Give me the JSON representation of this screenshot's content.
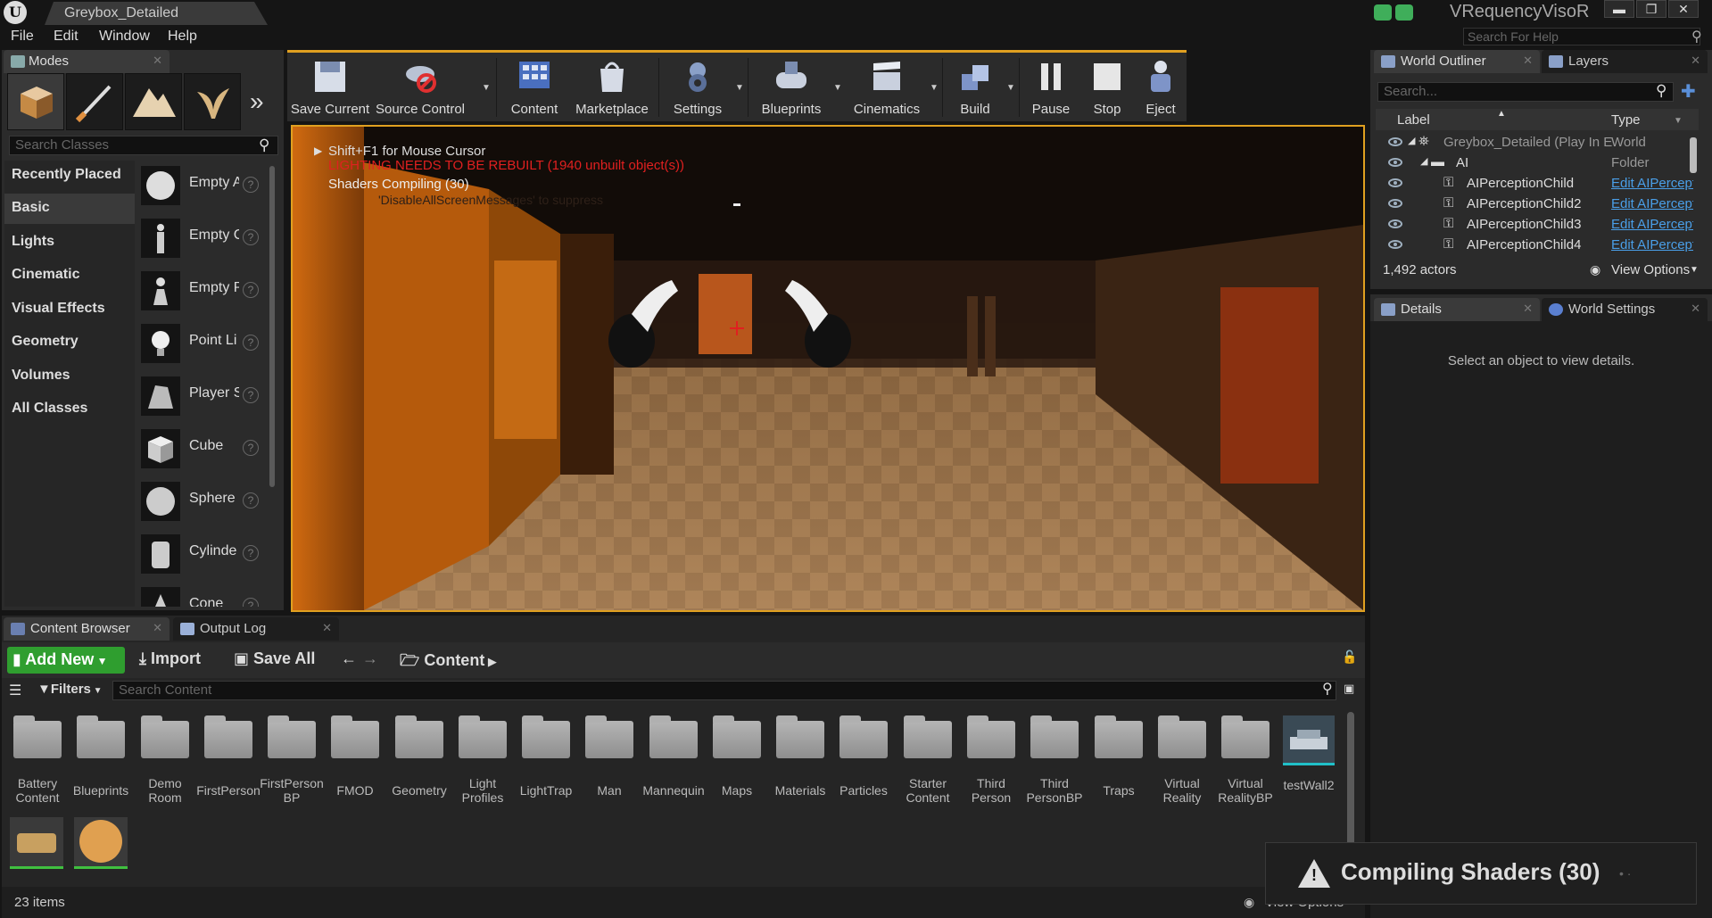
{
  "window": {
    "project_tab": "Greybox_Detailed",
    "studio_name": "VRequencyVisoR",
    "help_search_placeholder": "Search For Help",
    "controls": {
      "minimize": "▬",
      "maximize": "❐",
      "close": "✕"
    }
  },
  "menu": {
    "items": [
      "File",
      "Edit",
      "Window",
      "Help"
    ]
  },
  "modes": {
    "tab_label": "Modes",
    "search_placeholder": "Search Classes",
    "categories": [
      "Recently Placed",
      "Basic",
      "Lights",
      "Cinematic",
      "Visual Effects",
      "Geometry",
      "Volumes",
      "All Classes"
    ],
    "active_category": "Basic",
    "classes": [
      {
        "name": "Empty A",
        "icon": "sphere-icon"
      },
      {
        "name": "Empty C",
        "icon": "mannequin-icon"
      },
      {
        "name": "Empty P",
        "icon": "pawn-icon"
      },
      {
        "name": "Point Li",
        "icon": "lightbulb-icon"
      },
      {
        "name": "Player S",
        "icon": "player-start-icon"
      },
      {
        "name": "Cube",
        "icon": "cube-icon"
      },
      {
        "name": "Sphere",
        "icon": "sphere-icon"
      },
      {
        "name": "Cylinde",
        "icon": "cylinder-icon"
      },
      {
        "name": "Cone",
        "icon": "cone-icon"
      }
    ]
  },
  "toolbar": {
    "buttons": [
      {
        "label": "Save Current",
        "icon": "save-icon"
      },
      {
        "label": "Source Control",
        "icon": "source-control-icon"
      },
      {
        "label": "Content",
        "icon": "content-icon"
      },
      {
        "label": "Marketplace",
        "icon": "marketplace-icon"
      },
      {
        "label": "Settings",
        "icon": "settings-icon"
      },
      {
        "label": "Blueprints",
        "icon": "blueprints-icon"
      },
      {
        "label": "Cinematics",
        "icon": "cinematics-icon"
      },
      {
        "label": "Build",
        "icon": "build-icon"
      },
      {
        "label": "Pause",
        "icon": "pause-icon"
      },
      {
        "label": "Stop",
        "icon": "stop-icon"
      },
      {
        "label": "Eject",
        "icon": "eject-icon"
      }
    ]
  },
  "viewport": {
    "hint": "Shift+F1 for Mouse Cursor",
    "lighting_warning": "LIGHTING NEEDS TO BE REBUILT (1940 unbuilt object(s))",
    "shaders_status": "Shaders Compiling (30)",
    "suppress_hint": "'DisableAllScreenMessages' to suppress"
  },
  "content_browser": {
    "tabs": [
      "Content Browser",
      "Output Log"
    ],
    "add_new": "Add New",
    "import": "Import",
    "save_all": "Save All",
    "path": "Content",
    "filters": "Filters",
    "search_placeholder": "Search Content",
    "folders": [
      "Battery Content",
      "Blueprints",
      "Demo Room",
      "FirstPerson",
      "FirstPerson BP",
      "FMOD",
      "Geometry",
      "Light Profiles",
      "LightTrap",
      "Man",
      "Mannequin",
      "Maps",
      "Materials",
      "Particles",
      "Starter Content",
      "Third Person",
      "Third PersonBP",
      "Traps",
      "Virtual Reality",
      "Virtual RealityBP",
      "testWall2"
    ],
    "item_count": "23 items",
    "view_options": "View Options"
  },
  "outliner": {
    "tabs": [
      "World Outliner",
      "Layers"
    ],
    "search_placeholder": "Search...",
    "col_label": "Label",
    "col_type": "Type",
    "rows": [
      {
        "label": "Greybox_Detailed (Play In Editor)",
        "type": "World",
        "indent": 0
      },
      {
        "label": "AI",
        "type": "Folder",
        "indent": 1
      },
      {
        "label": "AIPerceptionChild",
        "type": "Edit AIPerception",
        "indent": 2
      },
      {
        "label": "AIPerceptionChild2",
        "type": "Edit AIPerception",
        "indent": 2
      },
      {
        "label": "AIPerceptionChild3",
        "type": "Edit AIPerception",
        "indent": 2
      },
      {
        "label": "AIPerceptionChild4",
        "type": "Edit AIPerception",
        "indent": 2
      }
    ],
    "actor_count": "1,492 actors",
    "view_options": "View Options"
  },
  "details": {
    "tabs": [
      "Details",
      "World Settings"
    ],
    "empty_message": "Select an object to view details."
  },
  "toast": {
    "message": "Compiling Shaders (30)"
  },
  "colors": {
    "accent_orange": "#e0a020",
    "add_new_green": "#2f9e2f",
    "link_blue": "#4a9fe8",
    "warning_red": "#e02020"
  }
}
